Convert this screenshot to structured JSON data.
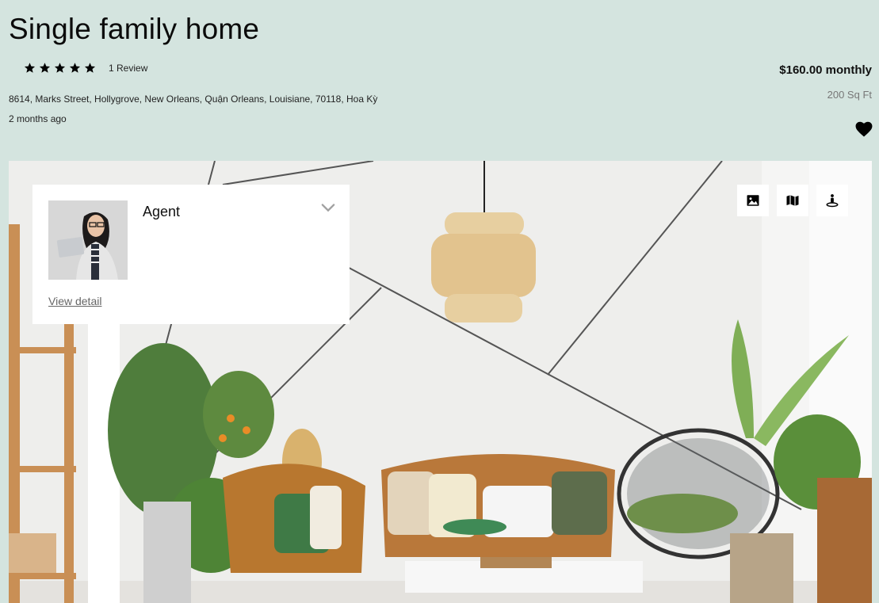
{
  "listing": {
    "title": "Single family home",
    "review_count": "1 Review",
    "rating": 5,
    "rating_max": 5,
    "price": "$160.00 monthly",
    "area": "200 Sq Ft",
    "address": "8614, Marks Street, Hollygrove, New Orleans, Quận Orleans, Louisiane, 70118, Hoa Kỳ",
    "posted": "2 months ago",
    "favorite_icon": "heart-icon"
  },
  "agent": {
    "label": "Agent",
    "link": "View detail"
  },
  "hero": {
    "view_buttons": [
      {
        "name": "photo-view-button",
        "icon": "image-icon"
      },
      {
        "name": "map-view-button",
        "icon": "map-icon"
      },
      {
        "name": "street-view-button",
        "icon": "street-view-icon"
      }
    ]
  },
  "colors": {
    "page_bg": "#d4e4df",
    "text": "#111111",
    "muted": "#777777"
  }
}
